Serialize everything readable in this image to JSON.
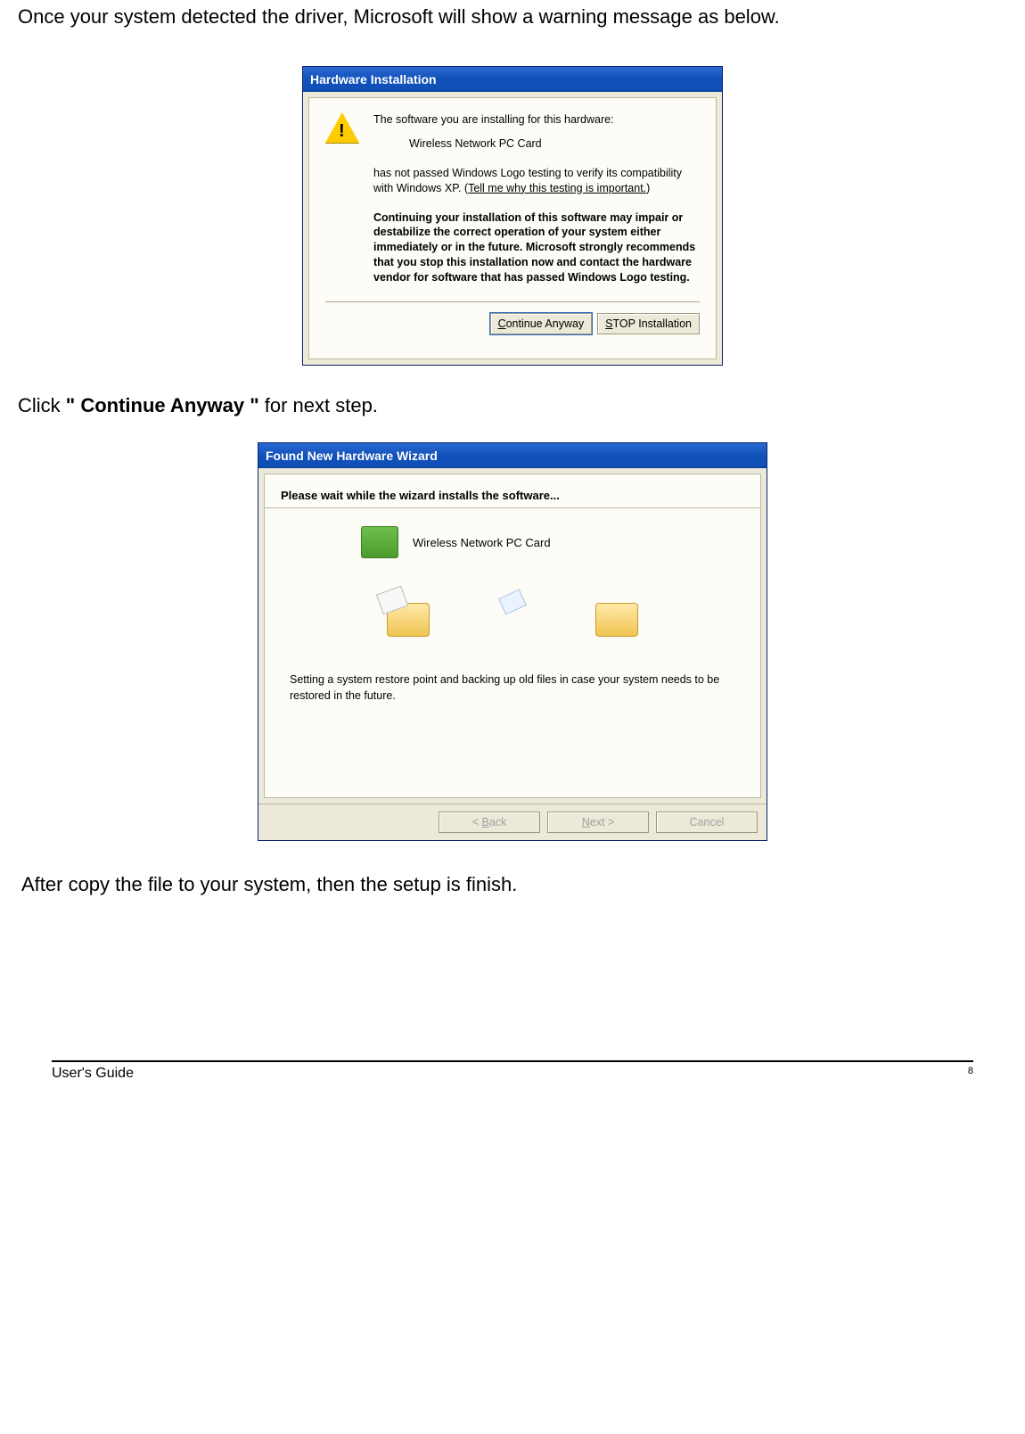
{
  "doc": {
    "intro": "Once your system detected the driver, Microsoft will show a warning message as below.",
    "click_prefix": "Click ",
    "click_bold": "\" Continue Anyway \"",
    "click_suffix": " for next step.",
    "after": "After copy the file to your system, then the setup is finish."
  },
  "dialog1": {
    "title": "Hardware Installation",
    "line1": "The software you are installing for this hardware:",
    "device": "Wireless Network PC Card",
    "line2a": "has not passed Windows Logo testing to verify its compatibility with Windows XP. (",
    "link": "Tell me why this testing is important.",
    "line2c": ")",
    "strong": "Continuing your installation of this software may impair or destabilize the correct operation of your system either immediately or in the future. Microsoft strongly recommends that you stop this installation now and contact the hardware vendor for software that has passed Windows Logo testing.",
    "btn_continue_pre": "",
    "btn_continue_ul": "C",
    "btn_continue_post": "ontinue Anyway",
    "btn_stop_pre": "",
    "btn_stop_ul": "S",
    "btn_stop_post": "TOP Installation"
  },
  "dialog2": {
    "title": "Found New Hardware Wizard",
    "head": "Please wait while the wizard installs the software...",
    "device": "Wireless Network PC Card",
    "status": "Setting a system restore point and backing up old files in case your system needs to be restored in the future.",
    "btn_back_pre": "< ",
    "btn_back_ul": "B",
    "btn_back_post": "ack",
    "btn_next_ul": "N",
    "btn_next_post": "ext >",
    "btn_cancel": "Cancel"
  },
  "footer": {
    "label": "User's Guide",
    "page": "8"
  }
}
